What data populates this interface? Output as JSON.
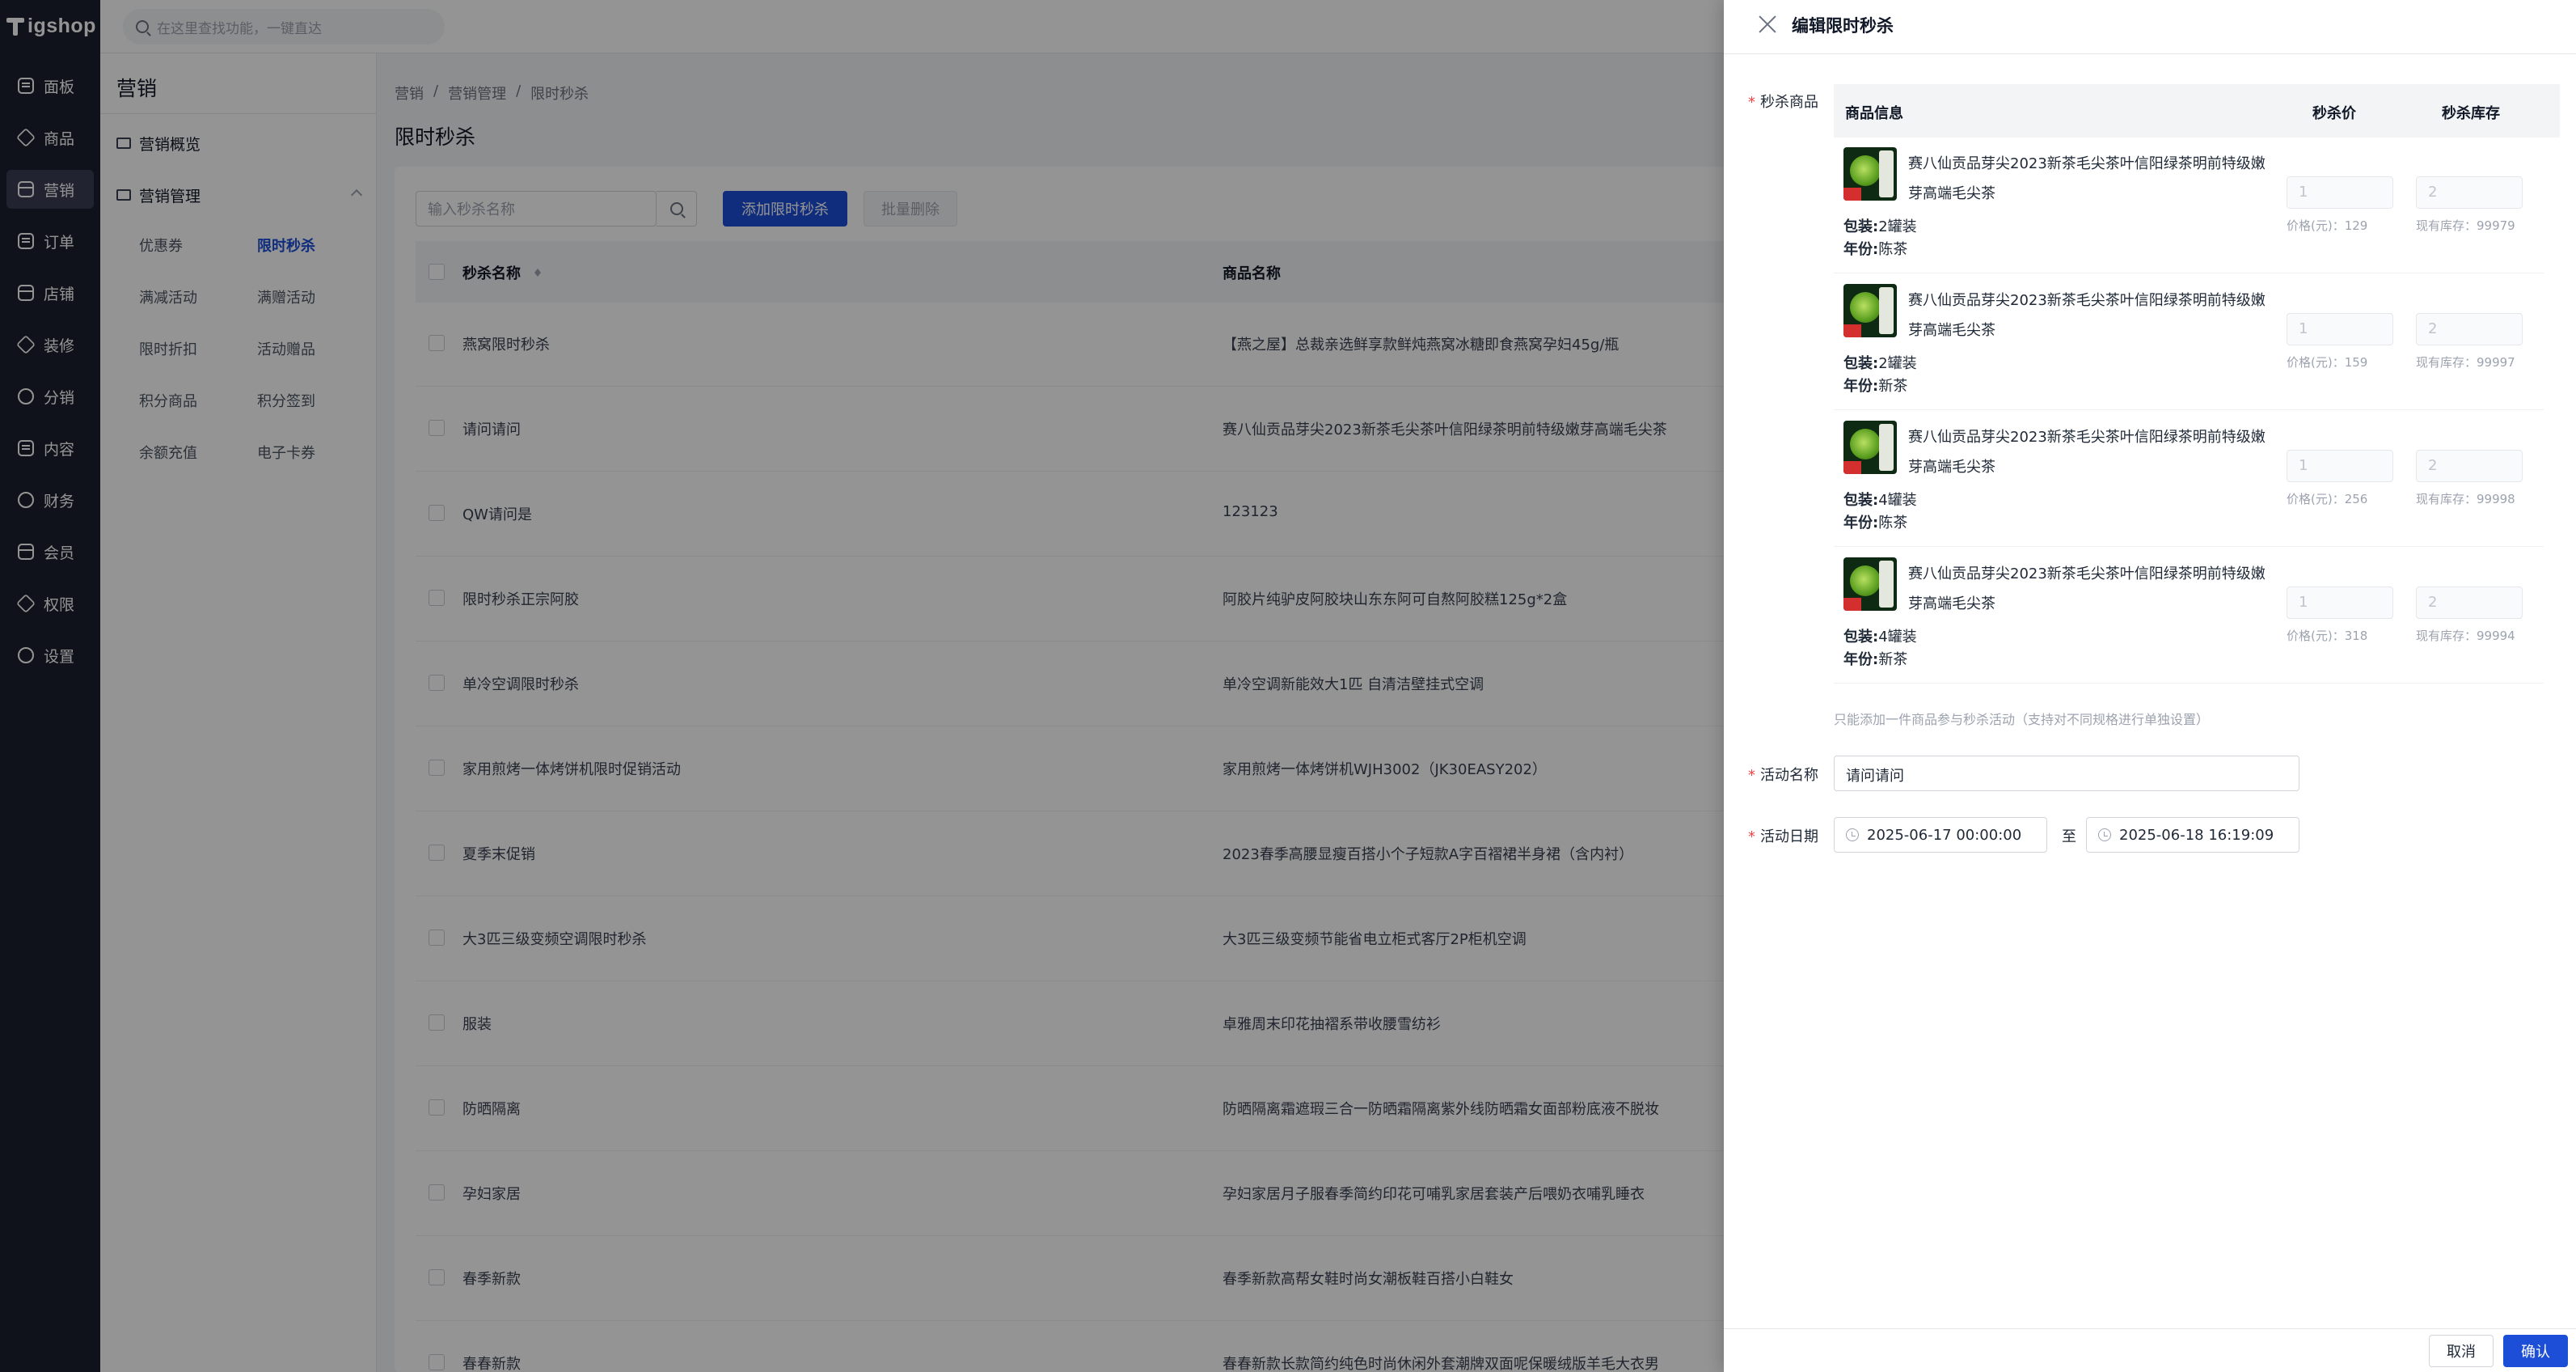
{
  "app": {
    "logo_text": "igshop"
  },
  "search": {
    "placeholder": "在这里查找功能，一键直达"
  },
  "nav": {
    "items": [
      {
        "label": "面板",
        "icon": "dashboard-icon"
      },
      {
        "label": "商品",
        "icon": "product-icon"
      },
      {
        "label": "营销",
        "icon": "marketing-icon",
        "active": true
      },
      {
        "label": "订单",
        "icon": "order-icon"
      },
      {
        "label": "店铺",
        "icon": "store-icon"
      },
      {
        "label": "装修",
        "icon": "decorate-icon"
      },
      {
        "label": "分销",
        "icon": "distribution-icon"
      },
      {
        "label": "内容",
        "icon": "content-icon"
      },
      {
        "label": "财务",
        "icon": "finance-icon"
      },
      {
        "label": "会员",
        "icon": "member-icon"
      },
      {
        "label": "权限",
        "icon": "permission-icon"
      },
      {
        "label": "设置",
        "icon": "settings-icon"
      }
    ]
  },
  "sidebar": {
    "title": "营销",
    "overview": "营销概览",
    "group": "营销管理",
    "subs": [
      "优惠券",
      "限时秒杀",
      "满减活动",
      "满赠活动",
      "限时折扣",
      "活动赠品",
      "积分商品",
      "积分签到",
      "余额充值",
      "电子卡券"
    ],
    "active_sub": "限时秒杀"
  },
  "breadcrumb": [
    "营销",
    "/",
    "营销管理",
    "/",
    "限时秒杀"
  ],
  "page": {
    "title": "限时秒杀",
    "search_placeholder": "输入秒杀名称",
    "add_button": "添加限时秒杀",
    "batch_delete": "批量删除",
    "columns": {
      "name": "秒杀名称",
      "product": "商品名称"
    }
  },
  "table": {
    "rows": [
      {
        "name": "燕窝限时秒杀",
        "product": "【燕之屋】总裁亲选鲜享款鲜炖燕窝冰糖即食燕窝孕妇45g/瓶"
      },
      {
        "name": "请问请问",
        "product": "赛八仙贡品芽尖2023新茶毛尖茶叶信阳绿茶明前特级嫩芽高端毛尖茶"
      },
      {
        "name": "QW请问是",
        "product": "123123"
      },
      {
        "name": "限时秒杀正宗阿胶",
        "product": "阿胶片纯驴皮阿胶块山东东阿可自熬阿胶糕125g*2盒"
      },
      {
        "name": "单冷空调限时秒杀",
        "product": "单冷空调新能效大1匹 自清洁壁挂式空调"
      },
      {
        "name": "家用煎烤一体烤饼机限时促销活动",
        "product": "家用煎烤一体烤饼机WJH3002（JK30EASY202）"
      },
      {
        "name": "夏季末促销",
        "product": "2023春季高腰显瘦百搭小个子短款A字百褶裙半身裙（含内衬）"
      },
      {
        "name": "大3匹三级变频空调限时秒杀",
        "product": "大3匹三级变频节能省电立柜式客厅2P柜机空调"
      },
      {
        "name": "服装",
        "product": "卓雅周末印花抽褶系带收腰雪纺衫"
      },
      {
        "name": "防晒隔离",
        "product": "防晒隔离霜遮瑕三合一防晒霜隔离紫外线防晒霜女面部粉底液不脱妆"
      },
      {
        "name": "孕妇家居",
        "product": "孕妇家居月子服春季简约印花可哺乳家居套装产后喂奶衣哺乳睡衣"
      },
      {
        "name": "春季新款",
        "product": "春季新款高帮女鞋时尚女潮板鞋百搭小白鞋女"
      },
      {
        "name": "春春新款",
        "product": "春春新款长款简约纯色时尚休闲外套潮牌双面呢保暖绒版羊毛大衣男"
      }
    ]
  },
  "drawer": {
    "title": "编辑限时秒杀",
    "label_products": "秒杀商品",
    "col_info": "商品信息",
    "col_price": "秒杀价",
    "col_stock": "秒杀库存",
    "products": [
      {
        "name": "赛八仙贡品芽尖2023新茶毛尖茶叶信阳绿茶明前特级嫩芽高端毛尖茶",
        "pack_label": "包装:",
        "pack": "2罐装",
        "year_label": "年份:",
        "year": "陈茶",
        "price_input": "1",
        "stock_input": "2",
        "price_hint": "价格(元)：129",
        "stock_hint": "现有库存：99979"
      },
      {
        "name": "赛八仙贡品芽尖2023新茶毛尖茶叶信阳绿茶明前特级嫩芽高端毛尖茶",
        "pack_label": "包装:",
        "pack": "2罐装",
        "year_label": "年份:",
        "year": "新茶",
        "price_input": "1",
        "stock_input": "2",
        "price_hint": "价格(元)：159",
        "stock_hint": "现有库存：99997"
      },
      {
        "name": "赛八仙贡品芽尖2023新茶毛尖茶叶信阳绿茶明前特级嫩芽高端毛尖茶",
        "pack_label": "包装:",
        "pack": "4罐装",
        "year_label": "年份:",
        "year": "陈茶",
        "price_input": "1",
        "stock_input": "2",
        "price_hint": "价格(元)：256",
        "stock_hint": "现有库存：99998"
      },
      {
        "name": "赛八仙贡品芽尖2023新茶毛尖茶叶信阳绿茶明前特级嫩芽高端毛尖茶",
        "pack_label": "包装:",
        "pack": "4罐装",
        "year_label": "年份:",
        "year": "新茶",
        "price_input": "1",
        "stock_input": "2",
        "price_hint": "价格(元)：318",
        "stock_hint": "现有库存：99994"
      }
    ],
    "tip": "只能添加一件商品参与秒杀活动（支持对不同规格进行单独设置）",
    "label_name": "活动名称",
    "name_value": "请问请问",
    "label_date": "活动日期",
    "date_start": "2025-06-17 00:00:00",
    "date_to": "至",
    "date_end": "2025-06-18 16:19:09",
    "cancel": "取消",
    "confirm": "确认"
  },
  "colors": {
    "primary": "#1d4ed8",
    "nav_bg": "#1d2030",
    "required": "#ef4444"
  }
}
